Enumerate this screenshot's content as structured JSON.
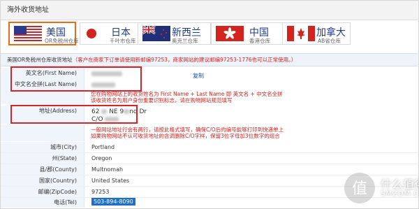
{
  "section_title": "海外收货地址",
  "warehouses": [
    {
      "name": "美国",
      "sub": "OR免税州仓库",
      "active": true,
      "flag": "us-flag"
    },
    {
      "name": "日本",
      "sub": "千叶市仓库",
      "active": false,
      "flag": "japan-flag"
    },
    {
      "name": "新西兰",
      "sub": "奥克兰仓库",
      "active": false,
      "flag": "new-zealand-flag"
    },
    {
      "name": "中国",
      "sub": "香港仓库",
      "active": false,
      "flag": "hong-kong-flag"
    },
    {
      "name": "加拿大",
      "sub": "AB省仓库",
      "active": false,
      "flag": "canada-flag"
    }
  ],
  "address_header": {
    "title": "美国OR免税州仓库收货地址",
    "notice": "（客户在商家下订单请使用新邮编97253，商家网站的建议邮编97253-1776也可以正常使用。）"
  },
  "fields": {
    "first_name_label": "英文名(First Name)",
    "last_name_label": "中文名全拼(Last Name)",
    "copy_label": "复制",
    "name_hint_line1": "您在购物网站上的收货姓名为 First Name + Last Name 即 英文名 + 中文名全拼",
    "name_hint_line2": "该收货姓名为用户身份重要识别标志，请在购物网站规范填写",
    "address_label": "地址(Address)",
    "address_line1": "62",
    "address_line1_end": "NE 9",
    "address_line1_tail": "nd Dr",
    "address_line2": "C/O",
    "address_hint_line1": "一般网站地址行会有两行，请按此格式填写，确保C/O后的编号能够打印到快递单上",
    "address_hint_line2": "如果购物网站不认可收货地址的含调删除C/O字样，保留3位字母加3位数字的组合",
    "city_label": "城市(City)",
    "city_value": "Portland",
    "state_label": "州(State)",
    "state_value": "Oregon",
    "county_label": "县/郡(County)",
    "county_value": "Multnomah",
    "country_label": "国家(Country)",
    "country_value": "United States",
    "zip_label": "邮编(ZipCode)",
    "zip_value": "97253",
    "tel_label": "电话(Tel)",
    "tel_value": "503-894-8090"
  },
  "watermark": {
    "text": "什么值得买",
    "sub": "SMZDM.COM"
  },
  "colors": {
    "accent_orange": "#e26d1d",
    "notice_red": "#d2231e",
    "highlight_blue": "#1f6fc8",
    "header_blue_bg": "#eef3fa"
  }
}
